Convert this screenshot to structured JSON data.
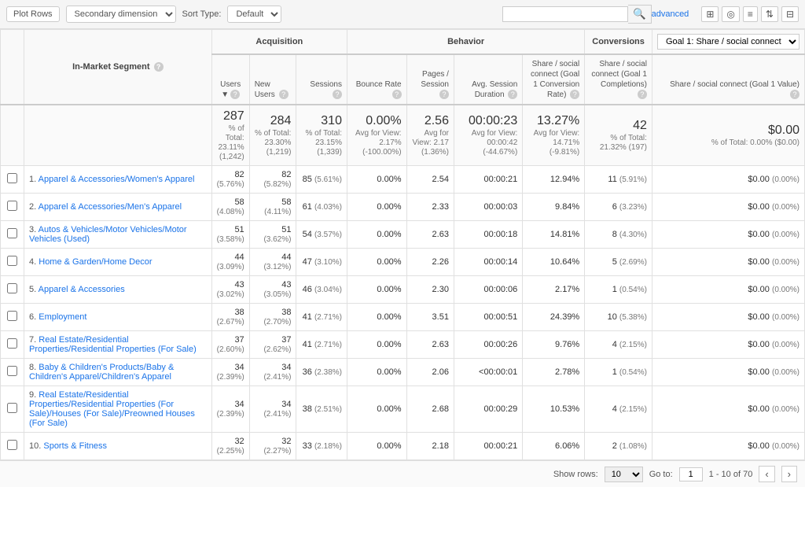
{
  "toolbar": {
    "plot_rows_label": "Plot Rows",
    "secondary_dimension_label": "Secondary dimension",
    "sort_type_label": "Sort Type:",
    "sort_default": "Default",
    "search_placeholder": "",
    "advanced_link": "advanced"
  },
  "icon_buttons": [
    "⊞",
    "◎",
    "≡",
    "⇅",
    "⊟"
  ],
  "table": {
    "group_headers": [
      {
        "label": "Acquisition",
        "colspan": 3
      },
      {
        "label": "Behavior",
        "colspan": 4
      },
      {
        "label": "Conversions",
        "colspan": 3
      }
    ],
    "goal_select_label": "Goal 1: Share / social connect",
    "segment_col_label": "In-Market Segment",
    "col_headers": [
      {
        "key": "users",
        "label": "Users",
        "sortable": true,
        "help": true
      },
      {
        "key": "new_users",
        "label": "New Users",
        "help": true
      },
      {
        "key": "sessions",
        "label": "Sessions",
        "help": true
      },
      {
        "key": "bounce_rate",
        "label": "Bounce Rate",
        "help": true
      },
      {
        "key": "pages_session",
        "label": "Pages / Session",
        "help": true
      },
      {
        "key": "avg_session",
        "label": "Avg. Session Duration",
        "help": true
      },
      {
        "key": "conversion_rate",
        "label": "Share / social connect (Goal 1 Conversion Rate)",
        "help": true
      },
      {
        "key": "completions",
        "label": "Share / social connect (Goal 1 Completions)",
        "help": true
      },
      {
        "key": "goal_value",
        "label": "Share / social connect (Goal 1 Value)",
        "help": true
      }
    ],
    "totals": {
      "users": "287",
      "users_sub": "% of Total: 23.11% (1,242)",
      "new_users": "284",
      "new_users_sub": "% of Total: 23.30% (1,219)",
      "sessions": "310",
      "sessions_sub": "% of Total: 23.15% (1,339)",
      "bounce_rate": "0.00%",
      "bounce_rate_sub": "Avg for View: 2.17% (-100.00%)",
      "pages_session": "2.56",
      "pages_session_sub": "Avg for View: 2.17 (1.36%)",
      "avg_session": "00:00:23",
      "avg_session_sub": "Avg for View: 00:00:42 (-44.67%)",
      "conversion_rate": "13.27%",
      "conversion_rate_sub": "Avg for View: 14.71% (-9.81%)",
      "completions": "42",
      "completions_sub": "% of Total: 21.32% (197)",
      "goal_value": "$0.00",
      "goal_value_sub": "% of Total: 0.00% ($0.00)"
    },
    "rows": [
      {
        "num": "1.",
        "segment": "Apparel & Accessories/Women's Apparel",
        "users": "82",
        "users_pct": "(5.76%)",
        "new_users": "82",
        "new_users_pct": "(5.82%)",
        "sessions": "85",
        "sessions_pct": "(5.61%)",
        "bounce_rate": "0.00%",
        "pages_session": "2.54",
        "avg_session": "00:00:21",
        "conversion_rate": "12.94%",
        "completions": "11",
        "completions_pct": "(5.91%)",
        "goal_value": "$0.00",
        "goal_value_pct": "(0.00%)"
      },
      {
        "num": "2.",
        "segment": "Apparel & Accessories/Men's Apparel",
        "users": "58",
        "users_pct": "(4.08%)",
        "new_users": "58",
        "new_users_pct": "(4.11%)",
        "sessions": "61",
        "sessions_pct": "(4.03%)",
        "bounce_rate": "0.00%",
        "pages_session": "2.33",
        "avg_session": "00:00:03",
        "conversion_rate": "9.84%",
        "completions": "6",
        "completions_pct": "(3.23%)",
        "goal_value": "$0.00",
        "goal_value_pct": "(0.00%)"
      },
      {
        "num": "3.",
        "segment": "Autos & Vehicles/Motor Vehicles/Motor Vehicles (Used)",
        "users": "51",
        "users_pct": "(3.58%)",
        "new_users": "51",
        "new_users_pct": "(3.62%)",
        "sessions": "54",
        "sessions_pct": "(3.57%)",
        "bounce_rate": "0.00%",
        "pages_session": "2.63",
        "avg_session": "00:00:18",
        "conversion_rate": "14.81%",
        "completions": "8",
        "completions_pct": "(4.30%)",
        "goal_value": "$0.00",
        "goal_value_pct": "(0.00%)"
      },
      {
        "num": "4.",
        "segment": "Home & Garden/Home Decor",
        "users": "44",
        "users_pct": "(3.09%)",
        "new_users": "44",
        "new_users_pct": "(3.12%)",
        "sessions": "47",
        "sessions_pct": "(3.10%)",
        "bounce_rate": "0.00%",
        "pages_session": "2.26",
        "avg_session": "00:00:14",
        "conversion_rate": "10.64%",
        "completions": "5",
        "completions_pct": "(2.69%)",
        "goal_value": "$0.00",
        "goal_value_pct": "(0.00%)"
      },
      {
        "num": "5.",
        "segment": "Apparel & Accessories",
        "users": "43",
        "users_pct": "(3.02%)",
        "new_users": "43",
        "new_users_pct": "(3.05%)",
        "sessions": "46",
        "sessions_pct": "(3.04%)",
        "bounce_rate": "0.00%",
        "pages_session": "2.30",
        "avg_session": "00:00:06",
        "conversion_rate": "2.17%",
        "completions": "1",
        "completions_pct": "(0.54%)",
        "goal_value": "$0.00",
        "goal_value_pct": "(0.00%)"
      },
      {
        "num": "6.",
        "segment": "Employment",
        "users": "38",
        "users_pct": "(2.67%)",
        "new_users": "38",
        "new_users_pct": "(2.70%)",
        "sessions": "41",
        "sessions_pct": "(2.71%)",
        "bounce_rate": "0.00%",
        "pages_session": "3.51",
        "avg_session": "00:00:51",
        "conversion_rate": "24.39%",
        "completions": "10",
        "completions_pct": "(5.38%)",
        "goal_value": "$0.00",
        "goal_value_pct": "(0.00%)"
      },
      {
        "num": "7.",
        "segment": "Real Estate/Residential Properties/Residential Properties (For Sale)",
        "users": "37",
        "users_pct": "(2.60%)",
        "new_users": "37",
        "new_users_pct": "(2.62%)",
        "sessions": "41",
        "sessions_pct": "(2.71%)",
        "bounce_rate": "0.00%",
        "pages_session": "2.63",
        "avg_session": "00:00:26",
        "conversion_rate": "9.76%",
        "completions": "4",
        "completions_pct": "(2.15%)",
        "goal_value": "$0.00",
        "goal_value_pct": "(0.00%)"
      },
      {
        "num": "8.",
        "segment": "Baby & Children's Products/Baby & Children's Apparel/Children's Apparel",
        "users": "34",
        "users_pct": "(2.39%)",
        "new_users": "34",
        "new_users_pct": "(2.41%)",
        "sessions": "36",
        "sessions_pct": "(2.38%)",
        "bounce_rate": "0.00%",
        "pages_session": "2.06",
        "avg_session": "<00:00:01",
        "conversion_rate": "2.78%",
        "completions": "1",
        "completions_pct": "(0.54%)",
        "goal_value": "$0.00",
        "goal_value_pct": "(0.00%)"
      },
      {
        "num": "9.",
        "segment": "Real Estate/Residential Properties/Residential Properties (For Sale)/Houses (For Sale)/Preowned Houses (For Sale)",
        "users": "34",
        "users_pct": "(2.39%)",
        "new_users": "34",
        "new_users_pct": "(2.41%)",
        "sessions": "38",
        "sessions_pct": "(2.51%)",
        "bounce_rate": "0.00%",
        "pages_session": "2.68",
        "avg_session": "00:00:29",
        "conversion_rate": "10.53%",
        "completions": "4",
        "completions_pct": "(2.15%)",
        "goal_value": "$0.00",
        "goal_value_pct": "(0.00%)"
      },
      {
        "num": "10.",
        "segment": "Sports & Fitness",
        "users": "32",
        "users_pct": "(2.25%)",
        "new_users": "32",
        "new_users_pct": "(2.27%)",
        "sessions": "33",
        "sessions_pct": "(2.18%)",
        "bounce_rate": "0.00%",
        "pages_session": "2.18",
        "avg_session": "00:00:21",
        "conversion_rate": "6.06%",
        "completions": "2",
        "completions_pct": "(1.08%)",
        "goal_value": "$0.00",
        "goal_value_pct": "(0.00%)"
      }
    ]
  },
  "footer": {
    "show_rows_label": "Show rows:",
    "show_rows_value": "10",
    "go_to_label": "Go to:",
    "go_to_value": "1",
    "pagination_label": "1 - 10 of 70"
  }
}
